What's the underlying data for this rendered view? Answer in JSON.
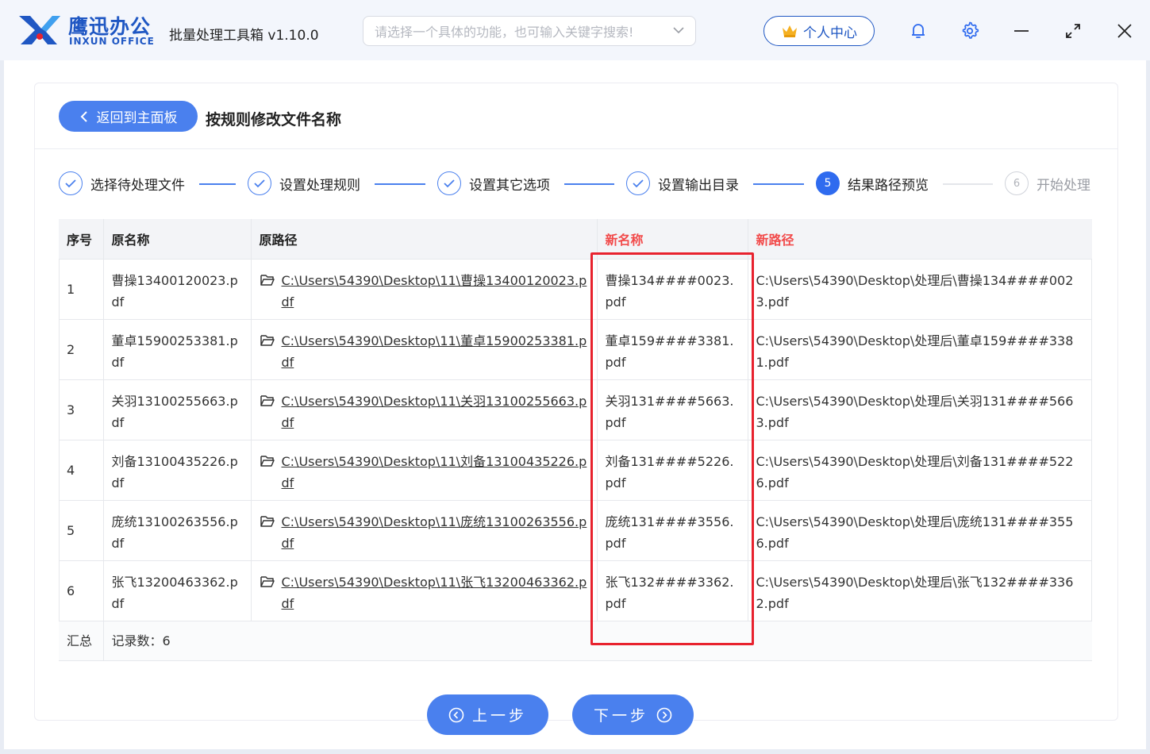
{
  "app": {
    "brand_cn": "鹰迅办公",
    "brand_en": "INXUN OFFICE",
    "title": "批量处理工具箱 v1.10.0",
    "search_placeholder": "请选择一个具体的功能，也可输入关键字搜索!",
    "personal_center": "个人中心",
    "icons": [
      "crown-icon",
      "bell-icon",
      "gear-icon",
      "minimize-icon",
      "maximize-icon",
      "close-icon"
    ]
  },
  "header": {
    "back_label": "返回到主面板",
    "page_title": "按规则修改文件名称"
  },
  "steps": [
    {
      "label": "选择待处理文件",
      "state": "done"
    },
    {
      "label": "设置处理规则",
      "state": "done"
    },
    {
      "label": "设置其它选项",
      "state": "done"
    },
    {
      "label": "设置输出目录",
      "state": "done"
    },
    {
      "label": "结果路径预览",
      "state": "active",
      "number": "5"
    },
    {
      "label": "开始处理",
      "state": "pending",
      "number": "6"
    }
  ],
  "table": {
    "columns": [
      "序号",
      "原名称",
      "原路径",
      "新名称",
      "新路径"
    ],
    "rows": [
      {
        "index": "1",
        "old_name": "曹操13400120023.pdf",
        "old_path": "C:\\Users\\54390\\Desktop\\11\\曹操13400120023.pdf",
        "new_name": "曹操134####0023.pdf",
        "new_path": "C:\\Users\\54390\\Desktop\\处理后\\曹操134####0023.pdf"
      },
      {
        "index": "2",
        "old_name": "董卓15900253381.pdf",
        "old_path": "C:\\Users\\54390\\Desktop\\11\\董卓15900253381.pdf",
        "new_name": "董卓159####3381.pdf",
        "new_path": "C:\\Users\\54390\\Desktop\\处理后\\董卓159####3381.pdf"
      },
      {
        "index": "3",
        "old_name": "关羽13100255663.pdf",
        "old_path": "C:\\Users\\54390\\Desktop\\11\\关羽13100255663.pdf",
        "new_name": "关羽131####5663.pdf",
        "new_path": "C:\\Users\\54390\\Desktop\\处理后\\关羽131####5663.pdf"
      },
      {
        "index": "4",
        "old_name": "刘备13100435226.pdf",
        "old_path": "C:\\Users\\54390\\Desktop\\11\\刘备13100435226.pdf",
        "new_name": "刘备131####5226.pdf",
        "new_path": "C:\\Users\\54390\\Desktop\\处理后\\刘备131####5226.pdf"
      },
      {
        "index": "5",
        "old_name": "庞统13100263556.pdf",
        "old_path": "C:\\Users\\54390\\Desktop\\11\\庞统13100263556.pdf",
        "new_name": "庞统131####3556.pdf",
        "new_path": "C:\\Users\\54390\\Desktop\\处理后\\庞统131####3556.pdf"
      },
      {
        "index": "6",
        "old_name": "张飞13200463362.pdf",
        "old_path": "C:\\Users\\54390\\Desktop\\11\\张飞13200463362.pdf",
        "new_name": "张飞132####3362.pdf",
        "new_path": "C:\\Users\\54390\\Desktop\\处理后\\张飞132####3362.pdf"
      }
    ],
    "summary_label": "汇总",
    "summary_value": "记录数：6"
  },
  "footer": {
    "prev_label": "上一步",
    "next_label": "下一步"
  },
  "colors": {
    "accent": "#4a80ee",
    "brand": "#1f57c3",
    "highlight": "#e8222e",
    "new_column_header": "#f24a4a"
  }
}
